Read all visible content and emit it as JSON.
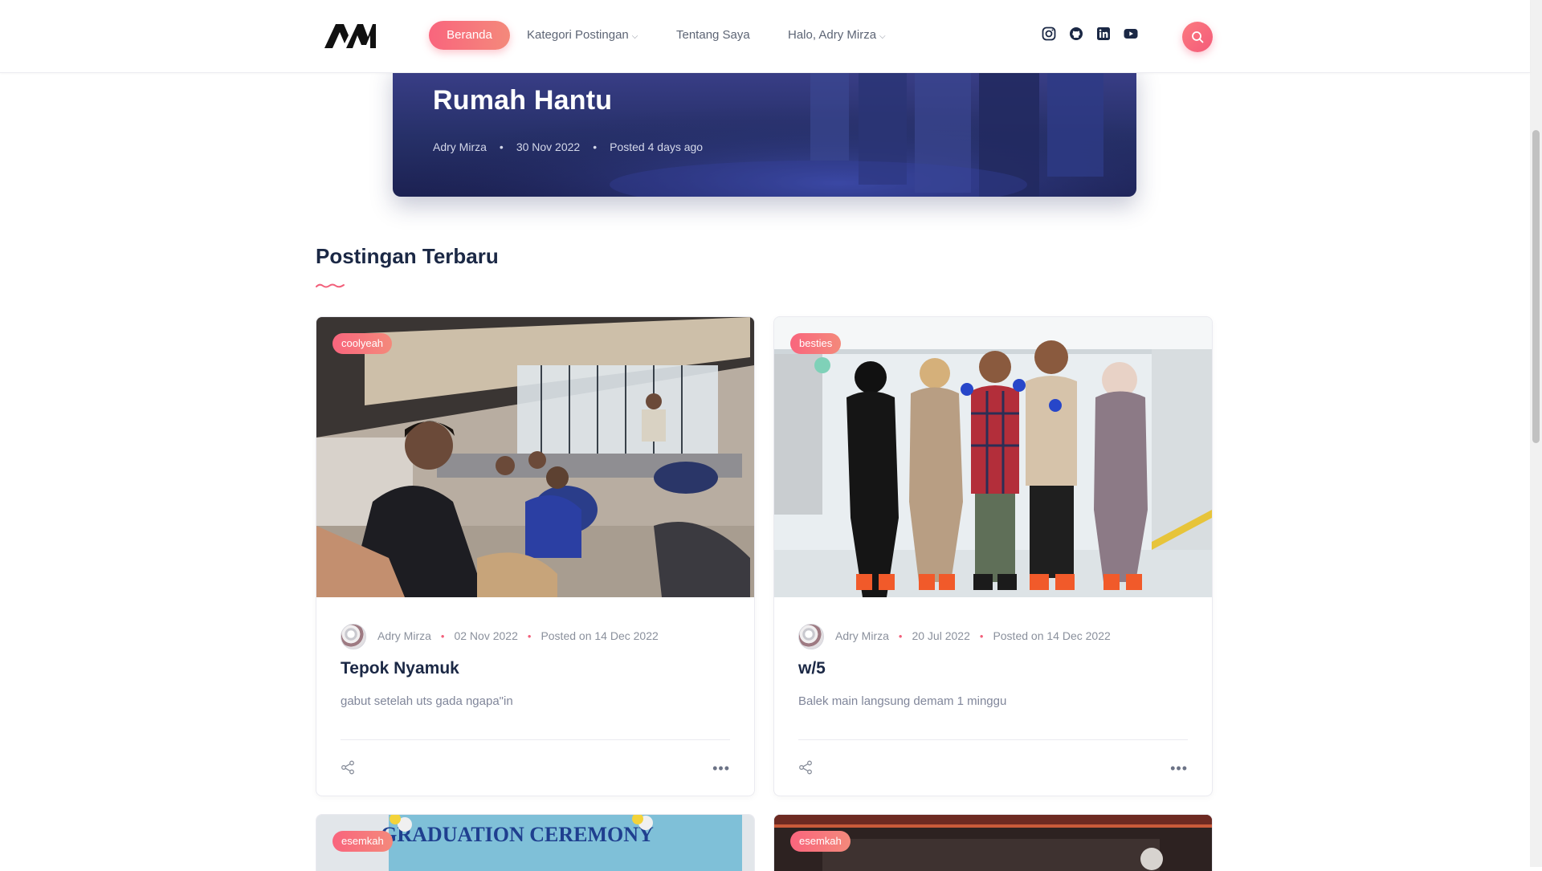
{
  "header": {
    "logo_text": "AM",
    "nav": {
      "home": "Beranda",
      "categories": "Kategori Postingan",
      "about": "Tentang Saya",
      "user": "Halo, Adry Mirza"
    },
    "social_icons": [
      "instagram-icon",
      "github-icon",
      "linkedin-icon",
      "youtube-icon"
    ],
    "accent": "#f9657d"
  },
  "hero": {
    "title": "Rumah Hantu",
    "author": "Adry Mirza",
    "date": "30 Nov 2022",
    "posted": "Posted 4 days ago"
  },
  "section": {
    "title": "Postingan Terbaru"
  },
  "posts": [
    {
      "tag": "coolyeah",
      "author": "Adry Mirza",
      "date": "02 Nov 2022",
      "posted": "Posted on 14 Dec 2022",
      "title": "Tepok Nyamuk",
      "excerpt": "gabut setelah uts gada ngapa\"in"
    },
    {
      "tag": "besties",
      "author": "Adry Mirza",
      "date": "20 Jul 2022",
      "posted": "Posted on 14 Dec 2022",
      "title": "w/5",
      "excerpt": "Balek main langsung demam 1 minggu"
    },
    {
      "tag": "esemkah",
      "banner_text": "GRADUATION CEREMONY"
    },
    {
      "tag": "esemkah"
    }
  ]
}
